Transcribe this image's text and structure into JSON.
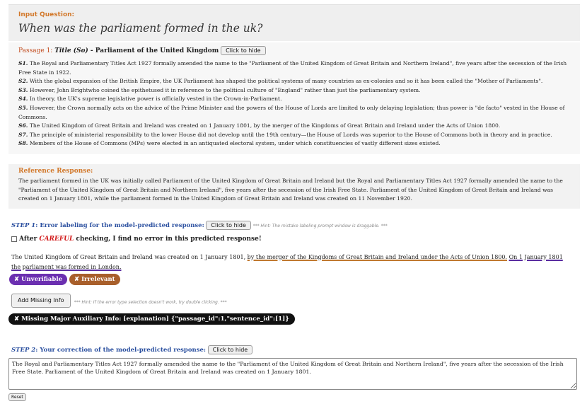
{
  "question": {
    "label": "Input Question:",
    "text": "When was the parliament formed in the uk?"
  },
  "passage": {
    "label_prefix": "Passage 1: ",
    "label_title": "Title (So)",
    "label_sep": " - ",
    "title": "Parliament of the United Kingdom",
    "hide_button": "Click to hide",
    "sentences": [
      {
        "id": "S1.",
        "text": " The Royal and Parliamentary Titles Act 1927 formally amended the name to the \"Parliament of the United Kingdom of Great Britain and Northern Ireland\", five years after the secession of the Irish Free State in 1922."
      },
      {
        "id": "S2.",
        "text": " With the global expansion of the British Empire, the UK Parliament has shaped the political systems of many countries as ex-colonies and so it has been called the \"Mother of Parliaments\"."
      },
      {
        "id": "S3.",
        "text": " However, John Brightwho coined the epithetused it in reference to the political culture of \"England\" rather than just the parliamentary system."
      },
      {
        "id": "S4.",
        "text": " In theory, the UK's supreme legislative power is officially vested in the Crown-in-Parliament."
      },
      {
        "id": "S5.",
        "text": " However, the Crown normally acts on the advice of the Prime Minister and the powers of the House of Lords are limited to only delaying legislation; thus power is \"de facto\" vested in the House of Commons."
      },
      {
        "id": "S6.",
        "text": " The United Kingdom of Great Britain and Ireland was created on 1 January 1801, by the merger of the Kingdoms of Great Britain and Ireland under the Acts of Union 1800."
      },
      {
        "id": "S7.",
        "text": " The principle of ministerial responsibility to the lower House did not develop until the 19th century—the House of Lords was superior to the House of Commons both in theory and in practice."
      },
      {
        "id": "S8.",
        "text": " Members of the House of Commons (MPs) were elected in an antiquated electoral system, under which constituencies of vastly different sizes existed."
      }
    ]
  },
  "reference": {
    "label": "Reference Response:",
    "text": "The parliament formed in the UK was initially called Parliament of the United Kingdom of Great Britain and Ireland but the Royal and Parliamentary Titles Act 1927 formally amended the name to the \"Parliament of the United Kingdom of Great Britain and Northern Ireland\", five years after the secession of the Irish Free State. Parliament of the United Kingdom of Great Britain and Ireland was created on 1 January 1801, while the parliament formed in the United Kingdom of Great Britain and Ireland was created on 11 November 1920."
  },
  "step1": {
    "step": "STEP 1",
    "title": ": Error labeling for the model-predicted response:",
    "hide_button": "Click to hide",
    "hint": "*** Hint: The mistake labeling prompt window is draggable. ***",
    "noerror_prefix": "After ",
    "noerror_careful": "CAREFUL",
    "noerror_suffix": " checking, I find no error in this predicted response!",
    "predicted_plain": "The United Kingdom of Great Britain and Ireland was created on 1 January 1801, ",
    "predicted_span1": "by the merger of the Kingdoms of Great Britain and Ireland under the Acts of Union 1800.",
    "predicted_gap": " ",
    "predicted_span2": "On 1 January 1801 the parliament was formed in London.",
    "tags": [
      "✘ Unverifiable",
      "✘ Irrelevant"
    ],
    "add_missing_button": "Add Missing Info",
    "add_missing_hint": "*** Hint: If the error type selection doesn't work, try double clicking. ***",
    "missing_tag": "✘ Missing Major Auxiliary Info: [explanation] {\"passage_id\":1,\"sentence_id\":[1]}"
  },
  "step2": {
    "step": "STEP 2",
    "title": ": Your correction of the model-predicted response:",
    "hide_button": "Click to hide",
    "correction_value": "The Royal and Parliamentary Titles Act 1927 formally amended the name to the \"Parliament of the United Kingdom of Great Britain and Northern Ireland\", five years after the secession of the Irish Free State. Parliament of the United Kingdom of Great Britain and Ireland was created on 1 January 1801.",
    "reset_button": "Reset"
  },
  "colors": {
    "orange_label": "#d2782a",
    "step_blue": "#2a4f9f",
    "purple_tag": "#6b2fb0",
    "orange_tag": "#a85f2b",
    "careful_red": "#d11a1a"
  }
}
